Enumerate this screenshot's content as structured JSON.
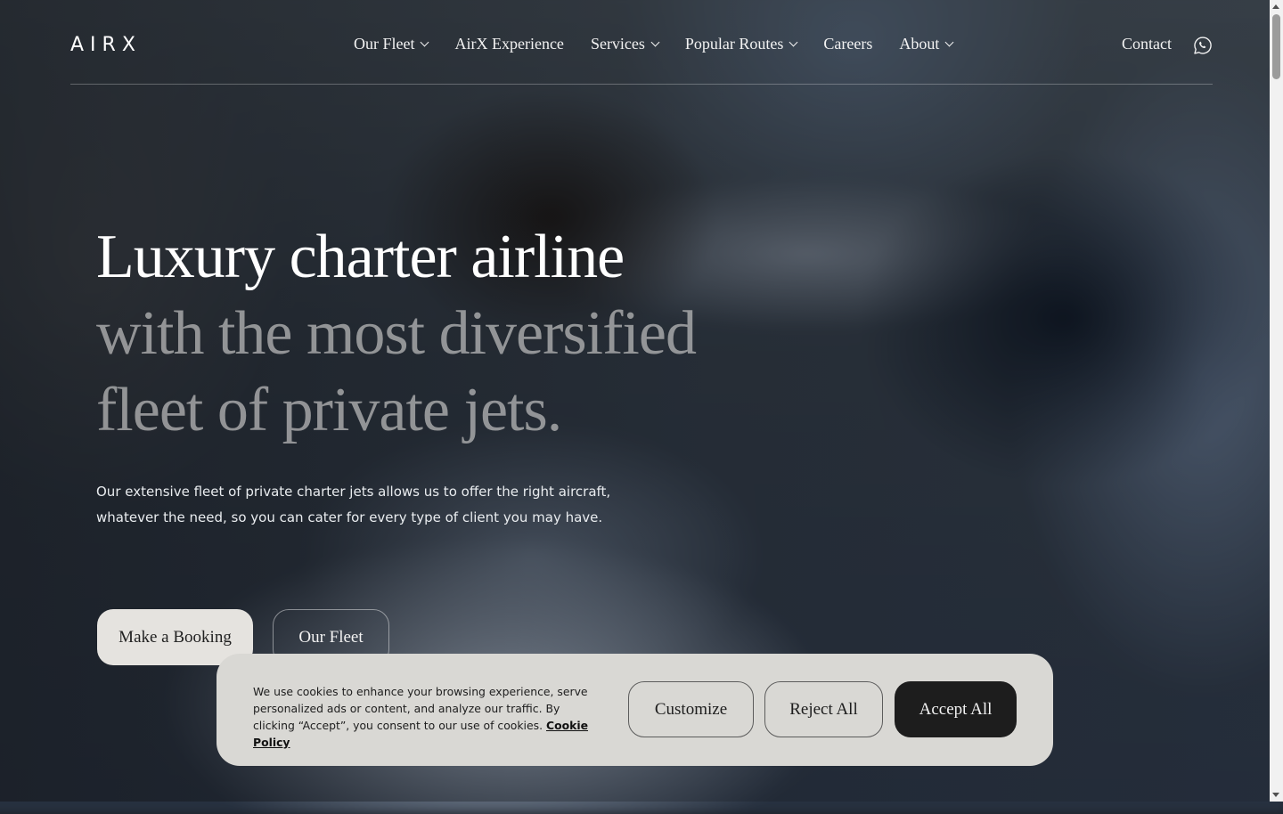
{
  "header": {
    "logo": "AIRX",
    "nav": [
      {
        "label": "Our Fleet",
        "has_dropdown": true
      },
      {
        "label": "AirX Experience",
        "has_dropdown": false
      },
      {
        "label": "Services",
        "has_dropdown": true
      },
      {
        "label": "Popular Routes",
        "has_dropdown": true
      },
      {
        "label": "Careers",
        "has_dropdown": false
      },
      {
        "label": "About",
        "has_dropdown": true
      }
    ],
    "contact_label": "Contact",
    "whatsapp_icon": "whatsapp-icon"
  },
  "hero": {
    "title_line1": "Luxury charter airline",
    "title_line2": "with the most diversified",
    "title_line3": "fleet of private jets.",
    "description": "Our extensive fleet of private charter jets allows us to offer the right aircraft, whatever the need, so you can cater for every type of client you may have.",
    "primary_button": "Make a Booking",
    "secondary_button": "Our Fleet"
  },
  "cookie_banner": {
    "text": "We use cookies to enhance your browsing experience, serve personalized ads or content, and analyze our traffic. By clicking “Accept”, you consent to our use of cookies.",
    "link_label": "Cookie Policy",
    "customize_label": "Customize",
    "reject_label": "Reject All",
    "accept_label": "Accept All"
  },
  "colors": {
    "accent_dark": "#1d1d1d",
    "banner_bg": "#d9d8d4",
    "button_light": "#e5e3df"
  }
}
